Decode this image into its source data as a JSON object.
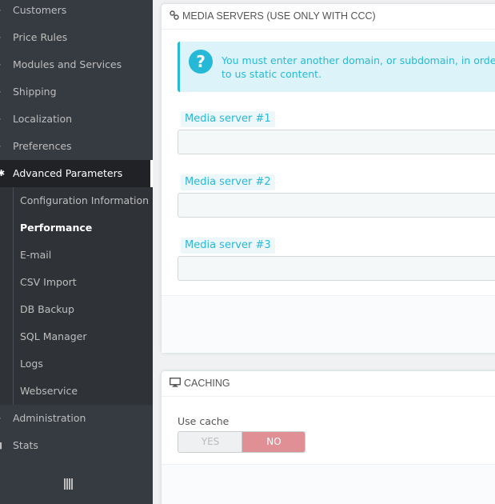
{
  "sidebar": {
    "items": [
      {
        "label": "Customers",
        "icon": "customers-icon"
      },
      {
        "label": "Price Rules",
        "icon": "price-rules-icon"
      },
      {
        "label": "Modules and Services",
        "icon": "modules-icon"
      },
      {
        "label": "Shipping",
        "icon": "shipping-icon"
      },
      {
        "label": "Localization",
        "icon": "localization-icon"
      },
      {
        "label": "Preferences",
        "icon": "preferences-icon"
      },
      {
        "label": "Advanced Parameters",
        "icon": "gears-icon"
      }
    ],
    "submenu": [
      {
        "label": "Configuration Information"
      },
      {
        "label": "Performance"
      },
      {
        "label": "E-mail"
      },
      {
        "label": "CSV Import"
      },
      {
        "label": "DB Backup"
      },
      {
        "label": "SQL Manager"
      },
      {
        "label": "Logs"
      },
      {
        "label": "Webservice"
      }
    ],
    "bottom_items": [
      {
        "label": "Administration",
        "icon": "administration-icon"
      },
      {
        "label": "Stats",
        "icon": "stats-icon"
      }
    ]
  },
  "media_servers": {
    "heading": "MEDIA SERVERS (USE ONLY WITH CCC)",
    "alert_text": "You must enter another domain, or subdomain, in order to us static content.",
    "fields": [
      {
        "label": "Media server #1",
        "value": ""
      },
      {
        "label": "Media server #2",
        "value": ""
      },
      {
        "label": "Media server #3",
        "value": ""
      }
    ]
  },
  "caching": {
    "heading": "CACHING",
    "use_cache_label": "Use cache",
    "yes_label": "YES",
    "no_label": "NO"
  },
  "colors": {
    "sidebar_bg": "#363a41",
    "accent": "#25b9d7",
    "switch_off": "#e08f95"
  }
}
